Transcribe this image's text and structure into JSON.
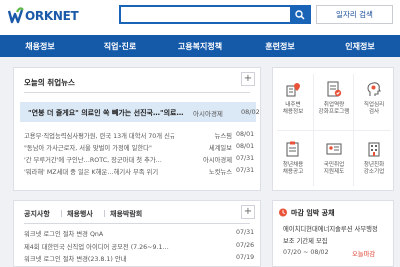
{
  "header": {
    "logo_text": "ORKNET",
    "search": {
      "value": "",
      "placeholder": ""
    },
    "detail_search_label": "일자리 검색"
  },
  "nav": {
    "items": [
      "채용정보",
      "직업·진로",
      "고용복지정책",
      "훈련정보",
      "인재정보"
    ]
  },
  "news": {
    "title": "오늘의 취업뉴스",
    "plus_label": "+",
    "headline": {
      "title": "\"연봉 더 줄게요\" 의료인 쏙 빼가는 선진국…\"의료…",
      "source": "아시아경제",
      "date": "08/02"
    },
    "items": [
      {
        "title": "고용부·직업능력심사평가원, 련국 13개 대학서 70개 신규 직…",
        "source": "뉴스핌",
        "date": "08/01"
      },
      {
        "title": "\"동남아 가사근로자, 서울 맞벌이 가정에 일한다\"",
        "source": "세계일보",
        "date": "08/01"
      },
      {
        "title": "'간 부루거간'에 구인난…ROTC, 장군마대 첫 추가…",
        "source": "아시아경제",
        "date": "07/31"
      },
      {
        "title": "'뭐라해' MZ세대 중 일은 K해운…해기사 부족 위기",
        "source": "노컷뉴스",
        "date": "07/31"
      }
    ]
  },
  "quick_menu": {
    "items": [
      {
        "label": "내주변\n채용정보",
        "icon": "building-pin-icon"
      },
      {
        "label": "취업역량\n강화프로그램",
        "icon": "document-check-icon"
      },
      {
        "label": "직업심리\n검사",
        "icon": "head-gear-icon"
      },
      {
        "label": "청년채용\n채용공고",
        "icon": "clipboard-icon"
      },
      {
        "label": "국민취업\n지원제도",
        "icon": "id-card-icon"
      },
      {
        "label": "청년친화\n강소기업",
        "icon": "office-building-icon"
      }
    ]
  },
  "notice": {
    "tabs": [
      "공지사항",
      "채용행사",
      "채용박람회"
    ],
    "plus_label": "+",
    "items": [
      {
        "title": "워크넷 로그인 절차 변경 QnA",
        "date": "07/31"
      },
      {
        "title": "제4회 대한민국 신직업 아이디어 공모전 (7.26~9.1…",
        "date": "07/26"
      },
      {
        "title": "워크넷 로그인 절차 변경(23.8.1) 안내",
        "date": "07/19"
      }
    ]
  },
  "deadline": {
    "title": "마감 임박 공채",
    "company": "에이치디현대에너지솔루션",
    "company_suffix": "사무행정",
    "desc": "보조 기간제 모집",
    "period": "07/20 ~ 08/02",
    "badge": "오늘마감"
  },
  "colors": {
    "brand": "#1559a9",
    "accent_green": "#5db848",
    "alert": "#e03b2c"
  }
}
